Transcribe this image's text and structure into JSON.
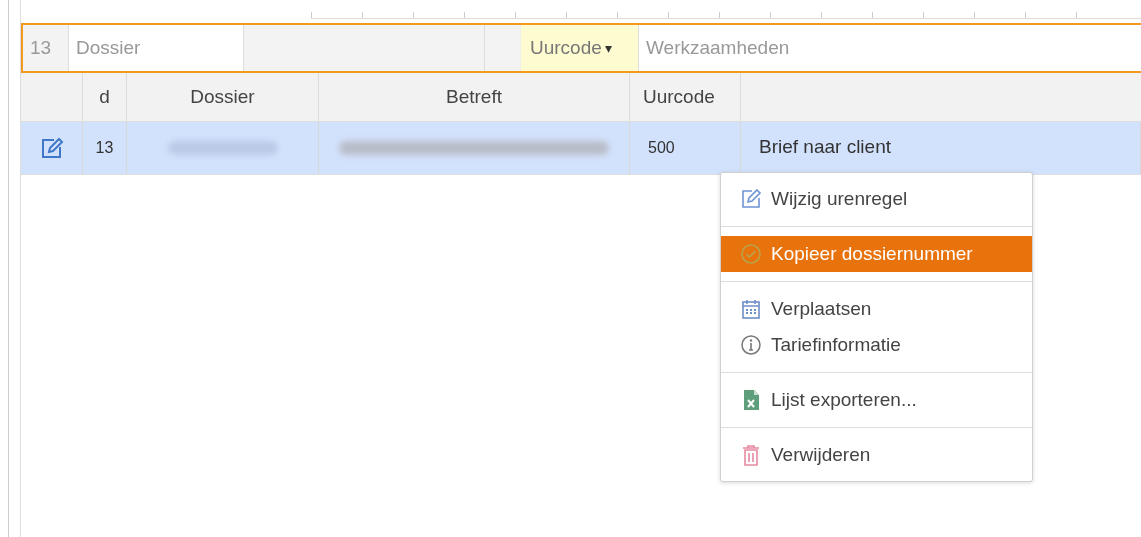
{
  "filter_row": {
    "row_count": "13",
    "dossier": {
      "placeholder": "Dossier"
    },
    "uurcode": {
      "label": "Uurcode",
      "caret": "▾"
    },
    "werkzaamheden": {
      "placeholder": "Werkzaamheden"
    }
  },
  "table": {
    "columns": [
      "d",
      "Dossier",
      "Betreft",
      "Uurcode"
    ],
    "rows": [
      {
        "selected": true,
        "d": "13",
        "uurcode": "500",
        "werkzaamheden": "Brief naar client"
      }
    ]
  },
  "context_menu": {
    "groups": [
      [
        {
          "label": "Wijzig urenregel",
          "selected": false
        }
      ],
      [
        {
          "label": "Kopieer dossiernummer",
          "selected": true
        }
      ],
      [
        {
          "label": "Verplaatsen",
          "selected": false
        },
        {
          "label": "Tariefinformatie",
          "selected": false
        }
      ],
      [
        {
          "label": "Lijst exporteren...",
          "selected": false
        }
      ],
      [
        {
          "label": "Verwijderen",
          "selected": false
        }
      ]
    ]
  }
}
